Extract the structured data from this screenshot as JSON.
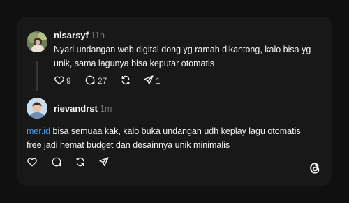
{
  "post": {
    "username": "nisarsyf",
    "time": "11h",
    "text_line1": "Nyari undangan web digital dong yg ramah dikantong, kalo bisa yg",
    "text_line2": "unik, sama lagunya bisa keputar otomatis",
    "likes": "9",
    "replies": "27",
    "shares": "1"
  },
  "reply": {
    "username": "rievandrst",
    "time": "1m",
    "mention": "mer.id",
    "text_line1_rest": " bisa semuaa kak, kalo buka undangan udh keplay lagu otomatis",
    "text_line2": "free jadi hemat budget dan desainnya unik minimalis"
  },
  "icons": {
    "like": "heart-icon",
    "reply": "comment-icon",
    "repost": "repost-icon",
    "share": "send-icon",
    "brand": "threads-logo-icon"
  },
  "colors": {
    "background": "#101010",
    "card": "#181818",
    "mention": "#4a9cf0",
    "muted": "#777777"
  }
}
